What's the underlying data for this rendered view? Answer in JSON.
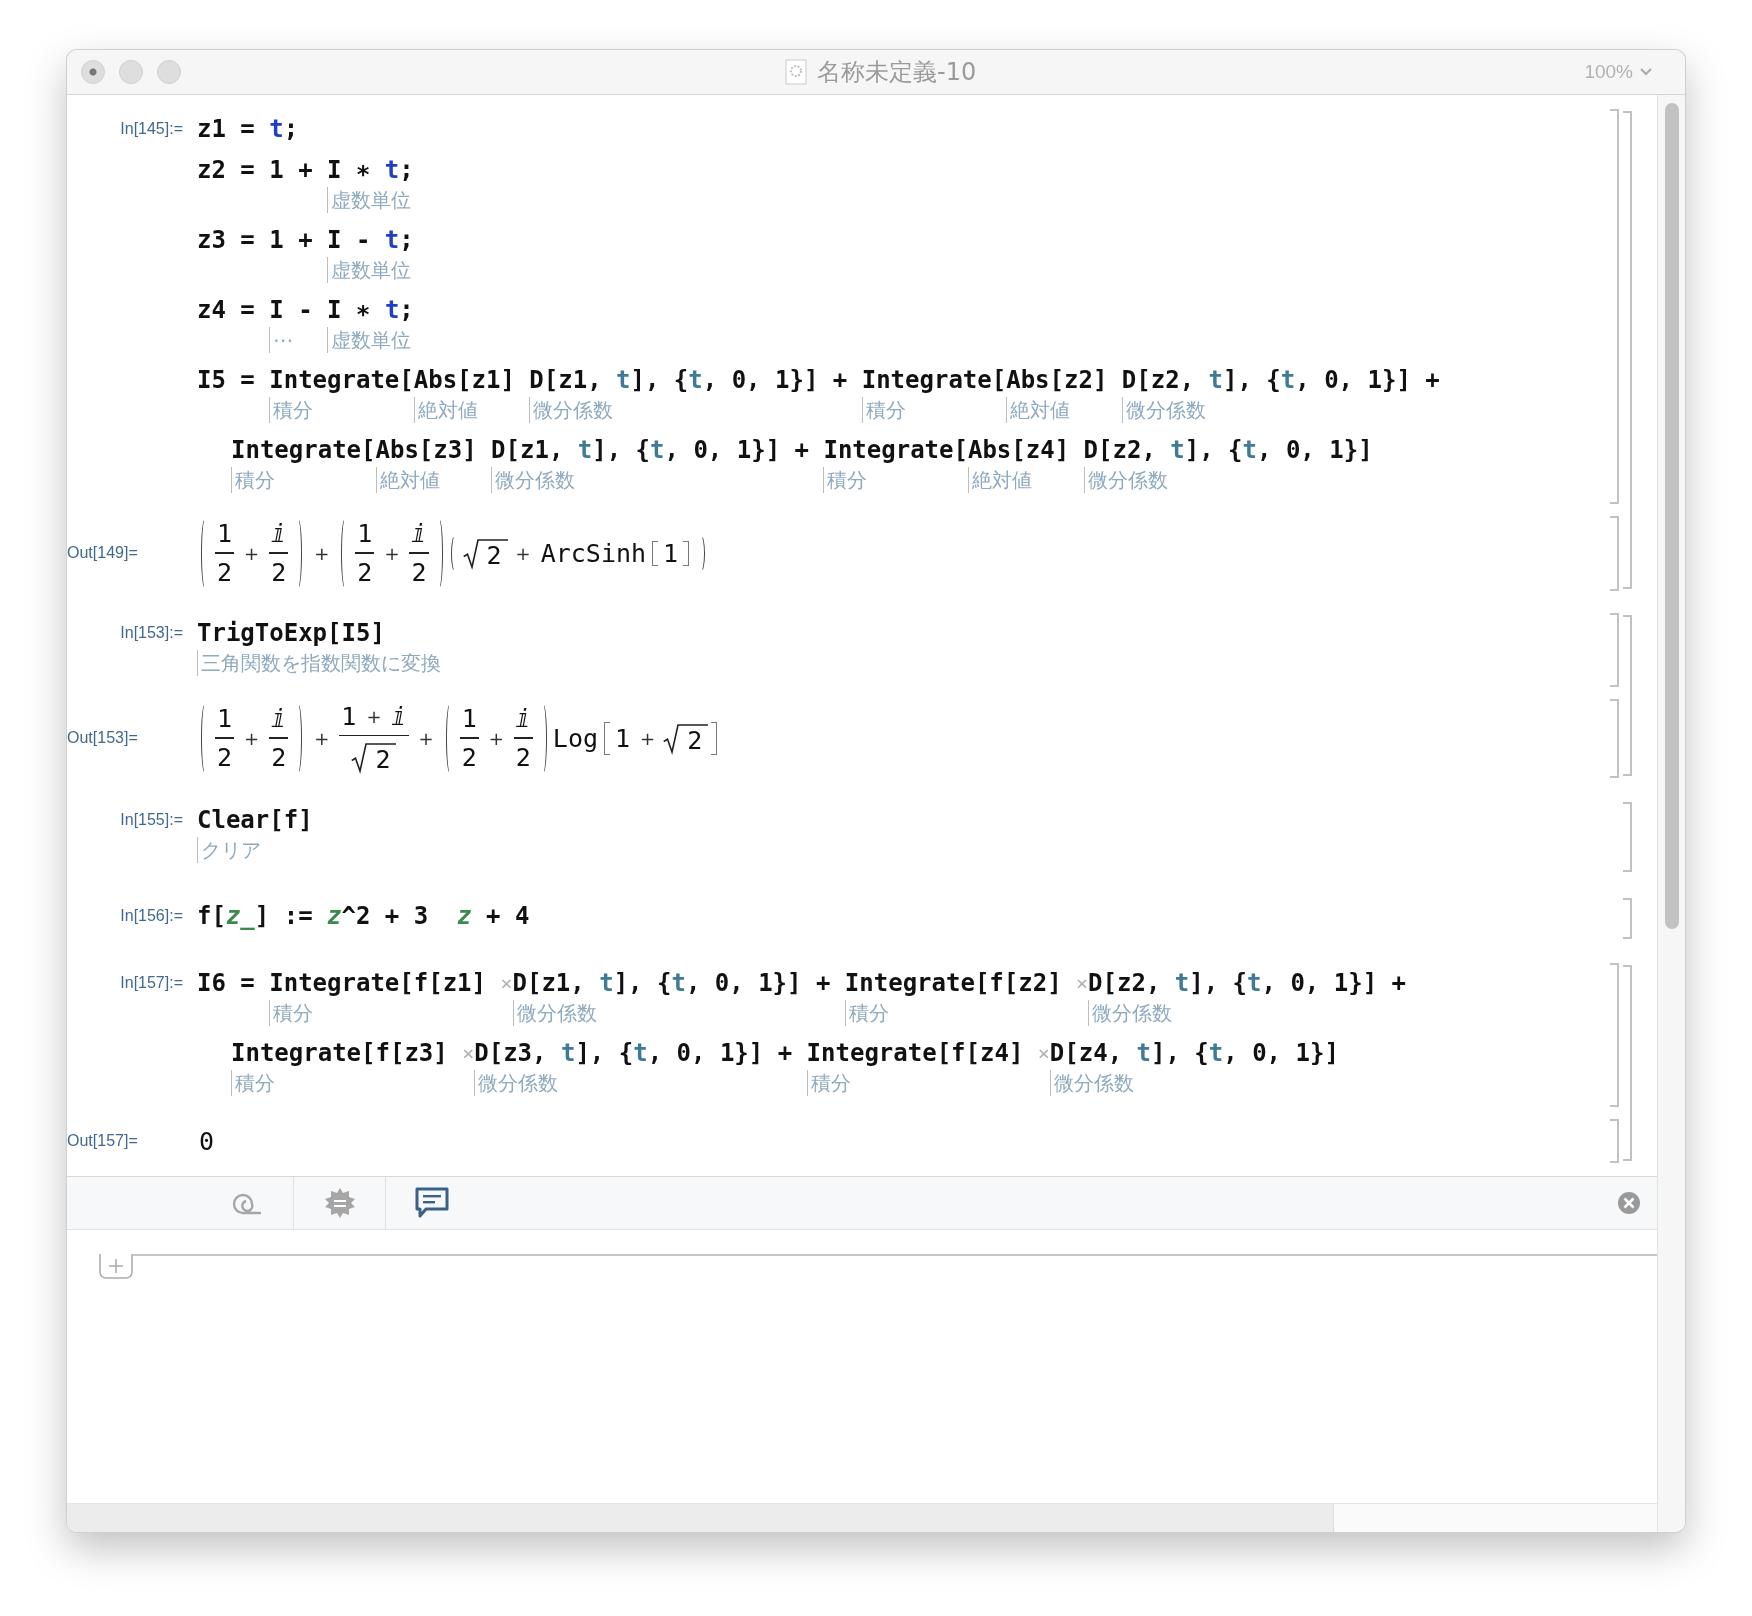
{
  "window": {
    "title": "名称未定義-10",
    "zoom": "100%"
  },
  "groups": [
    {
      "cells": [
        {
          "kind": "input",
          "label": "In[145]:=",
          "lines": [
            {
              "continuation": false,
              "tokens": [
                {
                  "text": "z1 = "
                },
                {
                  "text": "t",
                  "kind": "symbol"
                },
                {
                  "text": ";"
                }
              ]
            },
            {
              "continuation": false,
              "tokens": [
                {
                  "text": "z2 = 1 + "
                },
                {
                  "text": "I",
                  "hint": "虚数単位"
                },
                {
                  "text": " ∗ "
                },
                {
                  "text": "t",
                  "kind": "symbol"
                },
                {
                  "text": ";"
                }
              ]
            },
            {
              "continuation": false,
              "tokens": [
                {
                  "text": "z3 = 1 + "
                },
                {
                  "text": "I",
                  "hint": "虚数単位"
                },
                {
                  "text": " - "
                },
                {
                  "text": "t",
                  "kind": "symbol"
                },
                {
                  "text": ";"
                }
              ]
            },
            {
              "continuation": false,
              "tokens": [
                {
                  "text": "z4 = "
                },
                {
                  "text": "I",
                  "hint": "⋯"
                },
                {
                  "text": " - "
                },
                {
                  "text": "I",
                  "hint": "虚数単位"
                },
                {
                  "text": " ∗ "
                },
                {
                  "text": "t",
                  "kind": "symbol"
                },
                {
                  "text": ";"
                }
              ]
            },
            {
              "continuation": false,
              "tokens": [
                {
                  "text": "I5 = "
                },
                {
                  "text": "Integrate",
                  "hint": "積分"
                },
                {
                  "text": "["
                },
                {
                  "text": "Abs",
                  "hint": "絶対値"
                },
                {
                  "text": "[z1] "
                },
                {
                  "text": "D",
                  "hint": "微分係数"
                },
                {
                  "text": "[z1, "
                },
                {
                  "text": "t",
                  "kind": "iterator"
                },
                {
                  "text": "], {"
                },
                {
                  "text": "t",
                  "kind": "iterator"
                },
                {
                  "text": ", 0, 1}] + "
                },
                {
                  "text": "Integrate",
                  "hint": "積分"
                },
                {
                  "text": "["
                },
                {
                  "text": "Abs",
                  "hint": "絶対値"
                },
                {
                  "text": "[z2] "
                },
                {
                  "text": "D",
                  "hint": "微分係数"
                },
                {
                  "text": "[z2, "
                },
                {
                  "text": "t",
                  "kind": "iterator"
                },
                {
                  "text": "], {"
                },
                {
                  "text": "t",
                  "kind": "iterator"
                },
                {
                  "text": ", 0, 1}] +"
                }
              ]
            },
            {
              "continuation": true,
              "tokens": [
                {
                  "text": "Integrate",
                  "hint": "積分"
                },
                {
                  "text": "["
                },
                {
                  "text": "Abs",
                  "hint": "絶対値"
                },
                {
                  "text": "[z3] "
                },
                {
                  "text": "D",
                  "hint": "微分係数"
                },
                {
                  "text": "[z1, "
                },
                {
                  "text": "t",
                  "kind": "iterator"
                },
                {
                  "text": "], {"
                },
                {
                  "text": "t",
                  "kind": "iterator"
                },
                {
                  "text": ", 0, 1}] + "
                },
                {
                  "text": "Integrate",
                  "hint": "積分"
                },
                {
                  "text": "["
                },
                {
                  "text": "Abs",
                  "hint": "絶対値"
                },
                {
                  "text": "[z4] "
                },
                {
                  "text": "D",
                  "hint": "微分係数"
                },
                {
                  "text": "[z2, "
                },
                {
                  "text": "t",
                  "kind": "iterator"
                },
                {
                  "text": "], {"
                },
                {
                  "text": "t",
                  "kind": "iterator"
                },
                {
                  "text": ", 0, 1}]"
                }
              ]
            }
          ]
        },
        {
          "kind": "output",
          "label": "Out[149]=",
          "math": [
            {
              "kind": "paren",
              "items": [
                {
                  "kind": "frac",
                  "num": [
                    {
                      "kind": "text",
                      "text": "1"
                    }
                  ],
                  "den": [
                    {
                      "kind": "text",
                      "text": "2"
                    }
                  ]
                },
                {
                  "kind": "op",
                  "text": "+"
                },
                {
                  "kind": "frac",
                  "num": [
                    {
                      "kind": "text",
                      "text": "ⅈ"
                    }
                  ],
                  "den": [
                    {
                      "kind": "text",
                      "text": "2"
                    }
                  ]
                }
              ]
            },
            {
              "kind": "op",
              "text": "+"
            },
            {
              "kind": "paren",
              "items": [
                {
                  "kind": "frac",
                  "num": [
                    {
                      "kind": "text",
                      "text": "1"
                    }
                  ],
                  "den": [
                    {
                      "kind": "text",
                      "text": "2"
                    }
                  ]
                },
                {
                  "kind": "op",
                  "text": "+"
                },
                {
                  "kind": "frac",
                  "num": [
                    {
                      "kind": "text",
                      "text": "ⅈ"
                    }
                  ],
                  "den": [
                    {
                      "kind": "text",
                      "text": "2"
                    }
                  ]
                }
              ]
            },
            {
              "kind": "paren",
              "items": [
                {
                  "kind": "sqrt",
                  "items": [
                    {
                      "kind": "text",
                      "text": "2"
                    }
                  ]
                },
                {
                  "kind": "op",
                  "text": "+"
                },
                {
                  "kind": "text",
                  "text": "ArcSinh"
                },
                {
                  "kind": "bracket",
                  "items": [
                    {
                      "kind": "text",
                      "text": "1"
                    }
                  ]
                }
              ]
            }
          ]
        }
      ]
    },
    {
      "cells": [
        {
          "kind": "input",
          "label": "In[153]:=",
          "lines": [
            {
              "continuation": false,
              "tokens": [
                {
                  "text": "TrigToExp",
                  "hint": "三角関数を指数関数に変換"
                },
                {
                  "text": "[I5]"
                }
              ]
            }
          ]
        },
        {
          "kind": "output",
          "label": "Out[153]=",
          "math": [
            {
              "kind": "paren",
              "items": [
                {
                  "kind": "frac",
                  "num": [
                    {
                      "kind": "text",
                      "text": "1"
                    }
                  ],
                  "den": [
                    {
                      "kind": "text",
                      "text": "2"
                    }
                  ]
                },
                {
                  "kind": "op",
                  "text": "+"
                },
                {
                  "kind": "frac",
                  "num": [
                    {
                      "kind": "text",
                      "text": "ⅈ"
                    }
                  ],
                  "den": [
                    {
                      "kind": "text",
                      "text": "2"
                    }
                  ]
                }
              ]
            },
            {
              "kind": "op",
              "text": "+"
            },
            {
              "kind": "frac",
              "num": [
                {
                  "kind": "text",
                  "text": "1"
                },
                {
                  "kind": "op",
                  "text": "+"
                },
                {
                  "kind": "text",
                  "text": "ⅈ"
                }
              ],
              "den": [
                {
                  "kind": "sqrt",
                  "items": [
                    {
                      "kind": "text",
                      "text": "2"
                    }
                  ]
                }
              ]
            },
            {
              "kind": "op",
              "text": "+"
            },
            {
              "kind": "paren",
              "items": [
                {
                  "kind": "frac",
                  "num": [
                    {
                      "kind": "text",
                      "text": "1"
                    }
                  ],
                  "den": [
                    {
                      "kind": "text",
                      "text": "2"
                    }
                  ]
                },
                {
                  "kind": "op",
                  "text": "+"
                },
                {
                  "kind": "frac",
                  "num": [
                    {
                      "kind": "text",
                      "text": "ⅈ"
                    }
                  ],
                  "den": [
                    {
                      "kind": "text",
                      "text": "2"
                    }
                  ]
                }
              ]
            },
            {
              "kind": "text",
              "text": "Log"
            },
            {
              "kind": "bracket",
              "items": [
                {
                  "kind": "text",
                  "text": "1"
                },
                {
                  "kind": "op",
                  "text": "+"
                },
                {
                  "kind": "sqrt",
                  "items": [
                    {
                      "kind": "text",
                      "text": "2"
                    }
                  ]
                }
              ]
            }
          ]
        }
      ]
    },
    {
      "cells": [
        {
          "kind": "input",
          "label": "In[155]:=",
          "lines": [
            {
              "continuation": false,
              "tokens": [
                {
                  "text": "Clear",
                  "hint": "クリア"
                },
                {
                  "text": "[f]"
                }
              ]
            }
          ]
        }
      ]
    },
    {
      "cells": [
        {
          "kind": "input",
          "label": "In[156]:=",
          "lines": [
            {
              "continuation": false,
              "tokens": [
                {
                  "text": "f["
                },
                {
                  "text": "z_",
                  "kind": "pattern"
                },
                {
                  "text": "] := "
                },
                {
                  "text": "z",
                  "kind": "pattern"
                },
                {
                  "text": "^2 + 3  "
                },
                {
                  "text": "z",
                  "kind": "pattern"
                },
                {
                  "text": " + 4"
                }
              ]
            }
          ]
        }
      ]
    },
    {
      "cells": [
        {
          "kind": "input",
          "label": "In[157]:=",
          "lines": [
            {
              "continuation": false,
              "tokens": [
                {
                  "text": "I6 = "
                },
                {
                  "text": "Integrate",
                  "hint": "積分"
                },
                {
                  "text": "[f[z1] "
                },
                {
                  "text": "×",
                  "kind": "times"
                },
                {
                  "text": "D",
                  "hint": "微分係数"
                },
                {
                  "text": "[z1, "
                },
                {
                  "text": "t",
                  "kind": "iterator"
                },
                {
                  "text": "], {"
                },
                {
                  "text": "t",
                  "kind": "iterator"
                },
                {
                  "text": ", 0, 1}] + "
                },
                {
                  "text": "Integrate",
                  "hint": "積分"
                },
                {
                  "text": "[f[z2] "
                },
                {
                  "text": "×",
                  "kind": "times"
                },
                {
                  "text": "D",
                  "hint": "微分係数"
                },
                {
                  "text": "[z2, "
                },
                {
                  "text": "t",
                  "kind": "iterator"
                },
                {
                  "text": "], {"
                },
                {
                  "text": "t",
                  "kind": "iterator"
                },
                {
                  "text": ", 0, 1}] +"
                }
              ]
            },
            {
              "continuation": true,
              "tokens": [
                {
                  "text": "Integrate",
                  "hint": "積分"
                },
                {
                  "text": "[f[z3] "
                },
                {
                  "text": "×",
                  "kind": "times"
                },
                {
                  "text": "D",
                  "hint": "微分係数"
                },
                {
                  "text": "[z3, "
                },
                {
                  "text": "t",
                  "kind": "iterator"
                },
                {
                  "text": "], {"
                },
                {
                  "text": "t",
                  "kind": "iterator"
                },
                {
                  "text": ", 0, 1}] + "
                },
                {
                  "text": "Integrate",
                  "hint": "積分"
                },
                {
                  "text": "[f[z4] "
                },
                {
                  "text": "×",
                  "kind": "times"
                },
                {
                  "text": "D",
                  "hint": "微分係数"
                },
                {
                  "text": "[z4, "
                },
                {
                  "text": "t",
                  "kind": "iterator"
                },
                {
                  "text": "], {"
                },
                {
                  "text": "t",
                  "kind": "iterator"
                },
                {
                  "text": ", 0, 1}]"
                }
              ]
            }
          ]
        },
        {
          "kind": "output",
          "label": "Out[157]=",
          "math": [
            {
              "kind": "text",
              "text": "0"
            }
          ]
        }
      ]
    }
  ],
  "toolbar": {
    "tabs": [
      {
        "kind": "spiral",
        "selected": false
      },
      {
        "kind": "badge",
        "selected": false
      },
      {
        "kind": "chat",
        "selected": true
      }
    ]
  }
}
